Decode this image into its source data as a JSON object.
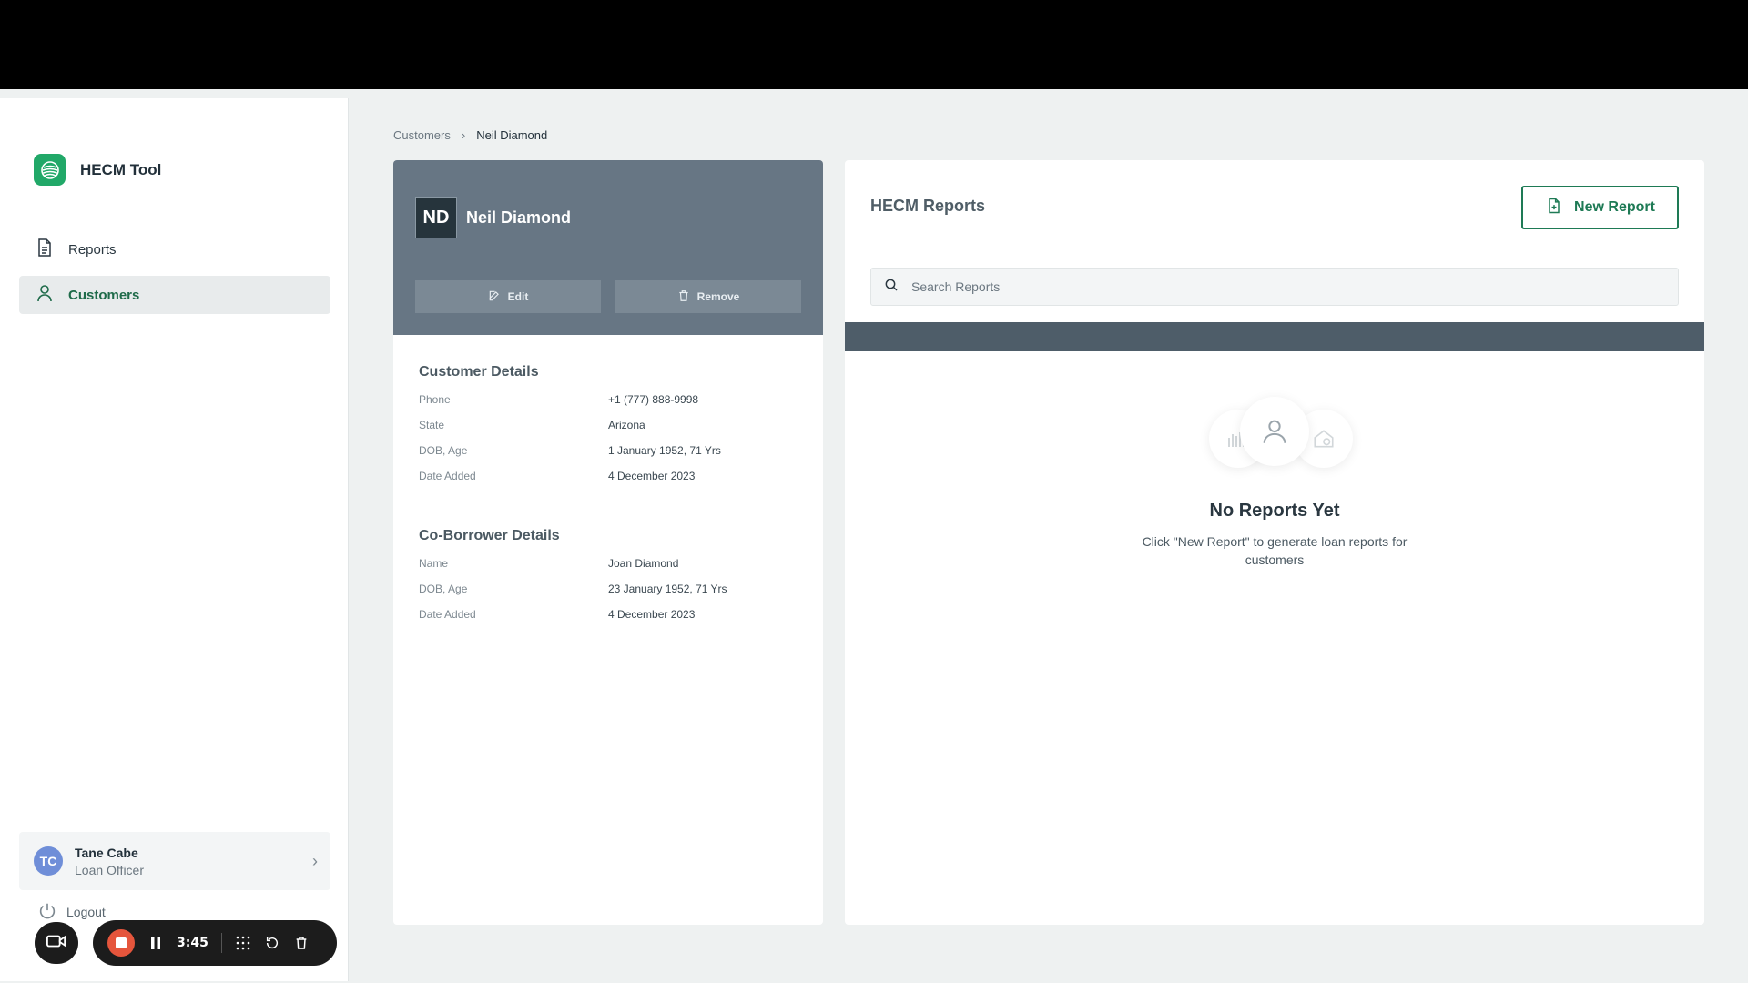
{
  "app": {
    "name": "HECM Tool"
  },
  "sidebar": {
    "items": [
      {
        "label": "Reports",
        "icon": "document-icon"
      },
      {
        "label": "Customers",
        "icon": "person-icon",
        "active": true
      }
    ],
    "user": {
      "initials": "TC",
      "name": "Tane Cabe",
      "role": "Loan Officer"
    },
    "logout_label": "Logout"
  },
  "recorder": {
    "time": "3:45"
  },
  "breadcrumb": {
    "parent": "Customers",
    "current": "Neil Diamond"
  },
  "customer": {
    "initials": "ND",
    "name": "Neil Diamond",
    "edit_label": "Edit",
    "remove_label": "Remove",
    "details_title": "Customer Details",
    "details": [
      {
        "key": "Phone",
        "value": "+1 (777) 888-9998"
      },
      {
        "key": "State",
        "value": "Arizona"
      },
      {
        "key": "DOB, Age",
        "value": "1 January 1952, 71 Yrs"
      },
      {
        "key": "Date Added",
        "value": "4 December 2023"
      }
    ],
    "coborrower_title": "Co-Borrower Details",
    "coborrower": [
      {
        "key": "Name",
        "value": "Joan Diamond"
      },
      {
        "key": "DOB, Age",
        "value": "23 January 1952, 71 Yrs"
      },
      {
        "key": "Date Added",
        "value": "4 December 2023"
      }
    ]
  },
  "reports": {
    "title": "HECM Reports",
    "new_report_label": "New Report",
    "search_placeholder": "Search Reports",
    "empty_title": "No Reports Yet",
    "empty_subtitle": "Click \"New Report\" to generate loan reports for customers"
  },
  "colors": {
    "accent": "#1e7a55",
    "brand": "#21a868",
    "header": "#677684"
  }
}
